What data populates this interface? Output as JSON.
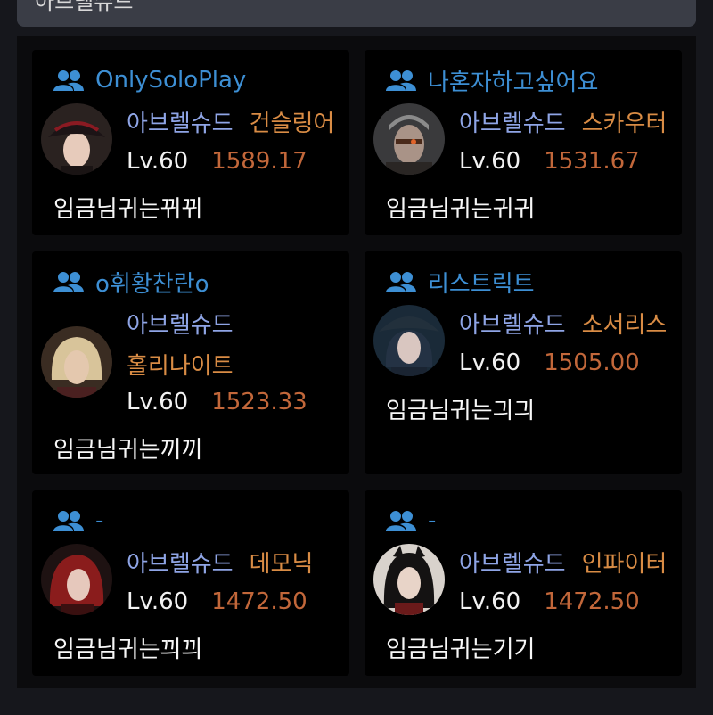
{
  "top_bar": {
    "text": "아브렐슈드"
  },
  "colors": {
    "guild": "#3d8fd4",
    "server": "#8fa5e6",
    "class": "#d98c45",
    "score": "#c2673a",
    "text": "#f7f7f7"
  },
  "cards": [
    {
      "guild": "OnlySoloPlay",
      "server": "아브렐슈드",
      "class": "건슬링어",
      "level": "Lv.60",
      "score": "1589.17",
      "name": "임금님귀는뀌뀌",
      "avatar_icon": "gunslinger-avatar"
    },
    {
      "guild": "나혼자하고싶어요",
      "server": "아브렐슈드",
      "class": "스카우터",
      "level": "Lv.60",
      "score": "1531.67",
      "name": "임금님귀는귀귀",
      "avatar_icon": "scouter-avatar"
    },
    {
      "guild": "o휘황찬란o",
      "server": "아브렐슈드",
      "class": "홀리나이트",
      "level": "Lv.60",
      "score": "1523.33",
      "name": "임금님귀는끼끼",
      "avatar_icon": "holyknight-avatar"
    },
    {
      "guild": "리스트릭트",
      "server": "아브렐슈드",
      "class": "소서리스",
      "level": "Lv.60",
      "score": "1505.00",
      "name": "임금님귀는긔긔",
      "avatar_icon": "sorceress-avatar"
    },
    {
      "guild": "-",
      "server": "아브렐슈드",
      "class": "데모닉",
      "level": "Lv.60",
      "score": "1472.50",
      "name": "임금님귀는끠끠",
      "avatar_icon": "demonic-avatar"
    },
    {
      "guild": "-",
      "server": "아브렐슈드",
      "class": "인파이터",
      "level": "Lv.60",
      "score": "1472.50",
      "name": "임금님귀는기기",
      "avatar_icon": "infighter-avatar"
    }
  ]
}
